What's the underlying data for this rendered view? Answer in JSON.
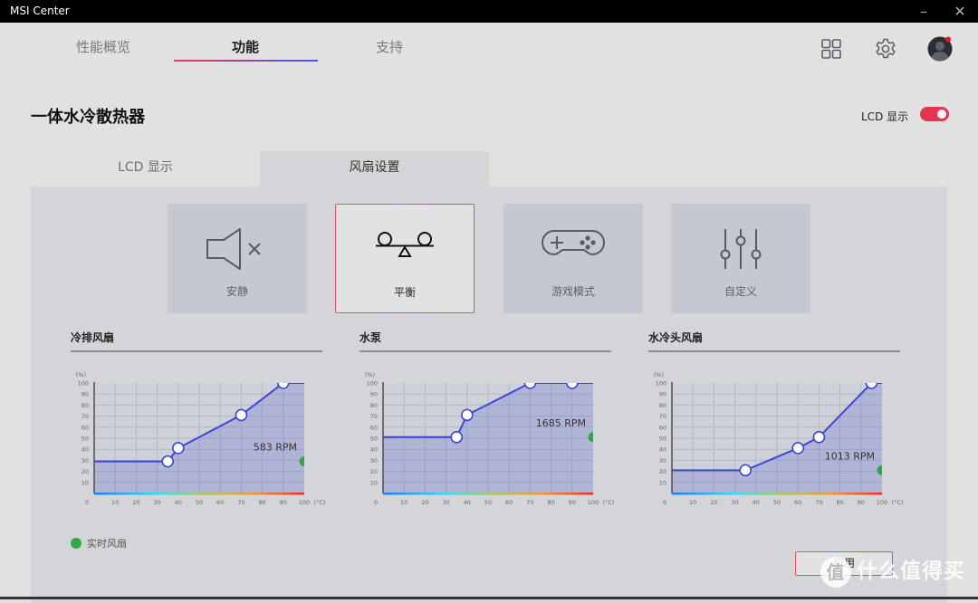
{
  "window": {
    "title": "MSI Center",
    "minimize_icon": "minimize-icon",
    "close_icon": "close-icon"
  },
  "nav": {
    "tabs": [
      {
        "label": "性能概览",
        "active": false
      },
      {
        "label": "功能",
        "active": true
      },
      {
        "label": "支持",
        "active": false
      }
    ],
    "icons": [
      "grid-apps-icon",
      "gear-icon",
      "user-avatar-icon"
    ],
    "avatar_notification": true
  },
  "page": {
    "title": "一体水冷散热器",
    "lcd_toggle_label": "LCD 显示",
    "lcd_toggle_on": true
  },
  "subtabs": [
    {
      "label": "LCD 显示",
      "active": false
    },
    {
      "label": "风扇设置",
      "active": true
    }
  ],
  "modes": [
    {
      "label": "安静",
      "icon": "speaker-mute-icon",
      "active": false
    },
    {
      "label": "平衡",
      "icon": "seesaw-balance-icon",
      "active": true
    },
    {
      "label": "游戏模式",
      "icon": "gamepad-icon",
      "active": false
    },
    {
      "label": "自定义",
      "icon": "sliders-icon",
      "active": false
    }
  ],
  "colors": {
    "accent_red": "#e5344f",
    "accent_blue": "#4a57e0",
    "curve": "#3a46d8",
    "realtime": "#2eaa44"
  },
  "legend": {
    "label": "实时风扇"
  },
  "apply_label": "应用",
  "watermark": {
    "glyph": "值",
    "text": "什么值得买"
  },
  "chart_data": [
    {
      "type": "line",
      "title": "冷排风扇",
      "ylabel": "(%)",
      "xlabel": "(°C)",
      "xlim": [
        0,
        100
      ],
      "ylim": [
        0,
        100
      ],
      "x_ticks": [
        0,
        10,
        20,
        30,
        40,
        50,
        60,
        70,
        80,
        90,
        100
      ],
      "y_ticks": [
        10,
        20,
        30,
        40,
        50,
        60,
        70,
        80,
        90,
        100
      ],
      "grid": true,
      "points": [
        [
          0,
          29
        ],
        [
          35,
          29
        ],
        [
          40,
          41
        ],
        [
          70,
          71
        ],
        [
          90,
          100
        ],
        [
          100,
          100
        ]
      ],
      "handles": [
        [
          35,
          29
        ],
        [
          40,
          41
        ],
        [
          70,
          71
        ],
        [
          90,
          100
        ]
      ],
      "realtime_percent": 29,
      "rpm_label": "583 RPM"
    },
    {
      "type": "line",
      "title": "水泵",
      "ylabel": "(%)",
      "xlabel": "(°C)",
      "xlim": [
        0,
        100
      ],
      "ylim": [
        0,
        100
      ],
      "x_ticks": [
        0,
        10,
        20,
        30,
        40,
        50,
        60,
        70,
        80,
        90,
        100
      ],
      "y_ticks": [
        10,
        20,
        30,
        40,
        50,
        60,
        70,
        80,
        90,
        100
      ],
      "grid": true,
      "points": [
        [
          0,
          51
        ],
        [
          35,
          51
        ],
        [
          40,
          71
        ],
        [
          70,
          100
        ],
        [
          90,
          100
        ],
        [
          100,
          100
        ]
      ],
      "handles": [
        [
          35,
          51
        ],
        [
          40,
          71
        ],
        [
          70,
          100
        ],
        [
          90,
          100
        ]
      ],
      "realtime_percent": 51,
      "rpm_label": "1685 RPM"
    },
    {
      "type": "line",
      "title": "水冷头风扇",
      "ylabel": "(%)",
      "xlabel": "(°C)",
      "xlim": [
        0,
        100
      ],
      "ylim": [
        0,
        100
      ],
      "x_ticks": [
        0,
        10,
        20,
        30,
        40,
        50,
        60,
        70,
        80,
        90,
        100
      ],
      "y_ticks": [
        10,
        20,
        30,
        40,
        50,
        60,
        70,
        80,
        90,
        100
      ],
      "grid": true,
      "points": [
        [
          0,
          21
        ],
        [
          35,
          21
        ],
        [
          60,
          41
        ],
        [
          70,
          51
        ],
        [
          95,
          100
        ],
        [
          100,
          100
        ]
      ],
      "handles": [
        [
          35,
          21
        ],
        [
          60,
          41
        ],
        [
          70,
          51
        ],
        [
          95,
          100
        ]
      ],
      "realtime_percent": 21,
      "rpm_label": "1013 RPM"
    }
  ]
}
